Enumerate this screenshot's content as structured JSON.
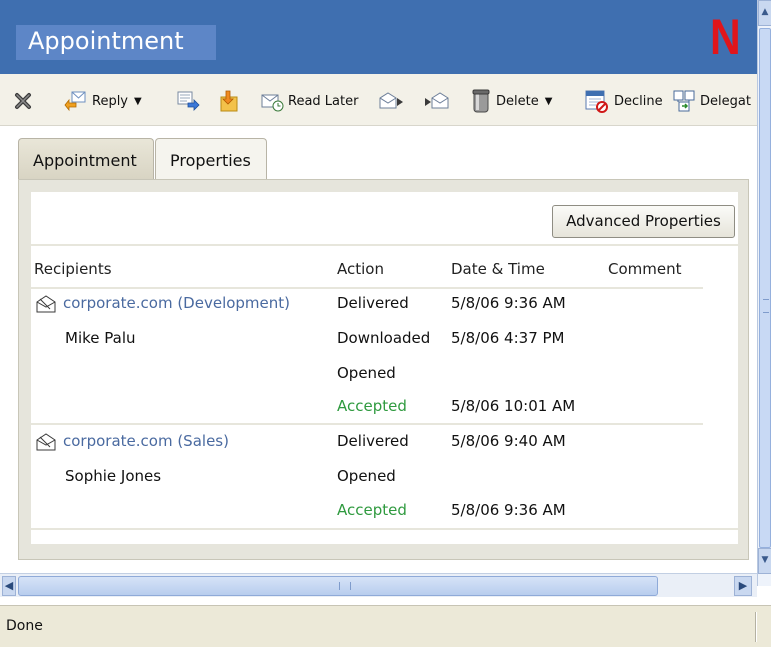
{
  "window": {
    "title": "Appointment",
    "logo_letter": "N"
  },
  "toolbar": {
    "reply_label": "Reply",
    "read_later_label": "Read Later",
    "delete_label": "Delete",
    "decline_label": "Decline",
    "delegate_label": "Delegat"
  },
  "tabs": [
    {
      "label": "Appointment",
      "selected": false
    },
    {
      "label": "Properties",
      "selected": true
    }
  ],
  "properties": {
    "advanced_button_label": "Advanced Properties",
    "columns": {
      "recipients": "Recipients",
      "action": "Action",
      "date_time": "Date & Time",
      "comment": "Comment"
    },
    "rows": [
      {
        "recipient": "corporate.com (Development)",
        "action": "Delivered",
        "date_time": "5/8/06 9:36 AM"
      },
      {
        "recipient": "Mike Palu",
        "action": "Downloaded",
        "date_time": "5/8/06 4:37 PM"
      },
      {
        "recipient": "",
        "action": "Opened",
        "date_time": ""
      },
      {
        "recipient": "",
        "action": "Accepted",
        "date_time": "5/8/06 10:01 AM"
      },
      {
        "recipient": "corporate.com (Sales)",
        "action": "Delivered",
        "date_time": "5/8/06 9:40 AM"
      },
      {
        "recipient": "Sophie Jones",
        "action": "Opened",
        "date_time": ""
      },
      {
        "recipient": "",
        "action": "Accepted",
        "date_time": "5/8/06 9:36 AM"
      }
    ]
  },
  "status": {
    "text": "Done"
  },
  "colors": {
    "titlebar": "#3f6fb0",
    "link": "#4a6aa0",
    "accepted": "#2f9a3f",
    "logo": "#e0151b"
  },
  "icons": [
    "close-x-icon",
    "reply-icon",
    "forward-icon",
    "move-icon",
    "read-later-icon",
    "next-icon",
    "previous-icon",
    "delete-trash-icon",
    "decline-icon",
    "delegate-icon",
    "envelope-icon"
  ]
}
